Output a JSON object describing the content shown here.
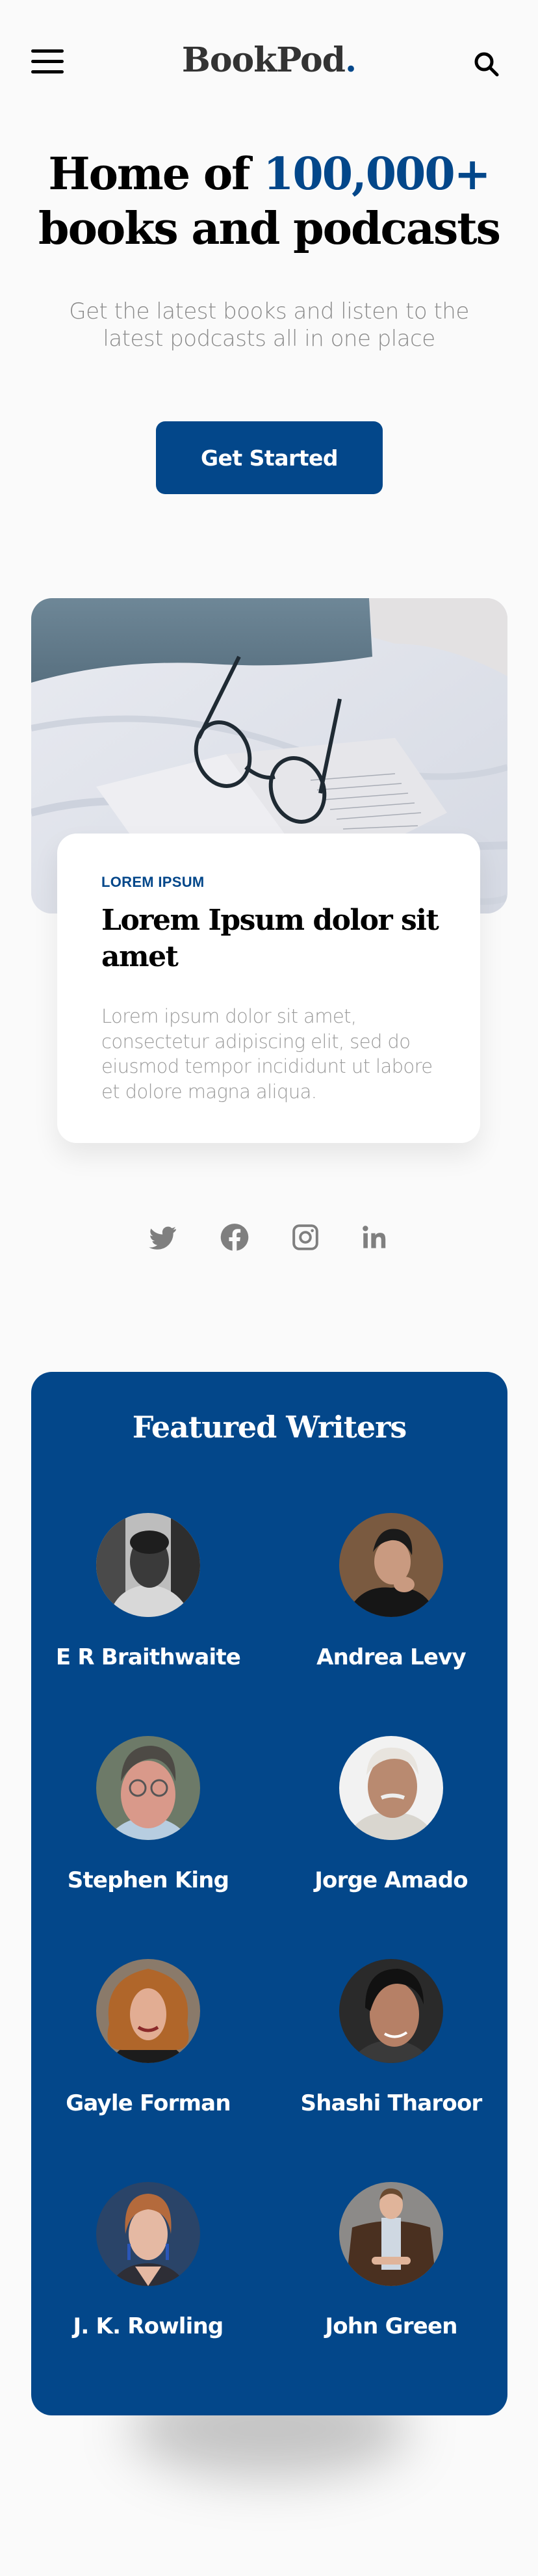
{
  "header": {
    "logo_text": "BookPod",
    "logo_dot": ".",
    "menu_icon": "hamburger-menu-icon",
    "search_icon": "search-icon"
  },
  "hero": {
    "headline_prefix": "Home of ",
    "headline_accent": "100,000+",
    "headline_suffix": "books and podcasts",
    "subtitle": "Get the latest books and listen to the latest podcasts all in one place",
    "cta_label": "Get Started"
  },
  "feature_card": {
    "image_alt": "Open book with reading glasses on a bed",
    "kicker": "LOREM IPSUM",
    "title": "Lorem Ipsum dolor sit amet",
    "body": "Lorem ipsum dolor sit amet, consectetur adipiscing elit, sed do eiusmod tempor incididunt ut labore et dolore magna aliqua."
  },
  "social": [
    {
      "name": "Twitter",
      "icon": "twitter-icon"
    },
    {
      "name": "Facebook",
      "icon": "facebook-icon"
    },
    {
      "name": "Instagram",
      "icon": "instagram-icon"
    },
    {
      "name": "LinkedIn",
      "icon": "linkedin-icon"
    }
  ],
  "featured_writers": {
    "title": "Featured Writers",
    "writers": [
      {
        "name": "E R Braithwaite"
      },
      {
        "name": "Andrea Levy"
      },
      {
        "name": "Stephen King"
      },
      {
        "name": "Jorge Amado"
      },
      {
        "name": "Gayle Forman"
      },
      {
        "name": "Shashi Tharoor"
      },
      {
        "name": "J. K. Rowling"
      },
      {
        "name": "John Green"
      }
    ]
  },
  "colors": {
    "brand": "#03478a",
    "background": "#fafafa",
    "muted_text": "#8a8a8a",
    "icon_gray": "#7f7f7f"
  }
}
